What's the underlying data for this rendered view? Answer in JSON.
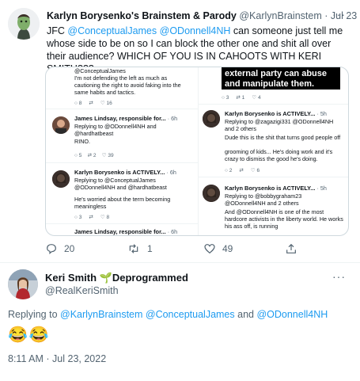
{
  "tweet1": {
    "display_name": "Karlyn Borysenko's Brainstem & Parody",
    "handle": "@KarlynBrainstem",
    "date": "· Jul 23",
    "text_prefix": "JFC ",
    "mention1": "@ConceptualJames",
    "mention2": "@ODonnell4NH",
    "text_rest": " can someone just tell me whose side to be on so I can block the other one and shit all over their audience? WHICH OF YOU IS IN CAHOOTS WITH KERI SMITH???",
    "actions": {
      "reply_count": "20",
      "retweet_count": "1",
      "like_count": "49"
    }
  },
  "screenshot": {
    "left": {
      "top_mention": "@ConceptualJames",
      "top_text": "I'm not defending the left as much as cautioning the right to avoid faking into the same habits and tactics.",
      "top_actions": [
        "8",
        "16"
      ],
      "reply1_name": "James Lindsay, responsible for...",
      "reply1_time": "· 6h",
      "reply1_replying": "Replying to @ODonnell4NH and @hardhatbeast",
      "reply1_text": "RINO.",
      "reply1_actions": [
        "5",
        "2",
        "39"
      ],
      "reply2_name": "Karlyn Borysenko is ACTIVELY...",
      "reply2_time": "· 6h",
      "reply2_replying": "Replying to @ConceptualJames @ODonnell4NH and @hardhatbeast",
      "reply2_text": "He's worried about the term becoming meaningless",
      "reply2_actions": [
        "3",
        "8"
      ],
      "reply3_name": "James Lindsay, responsible for...",
      "reply3_time": "· 6h"
    },
    "right": {
      "banner_text": "external party can abuse and manipulate them.",
      "top_actions": [
        "3",
        "1",
        "4"
      ],
      "reply1_name": "Karlyn Borysenko is ACTIVELY...",
      "reply1_time": "· 5h",
      "reply1_replying": "Replying to @zagazigi331 @ODonnell4NH and 2 others",
      "reply1_text": "Dude this is the shit that turns good people off",
      "reply1_overlap": "grooming of kids... He's doing work and it's crazy to dismiss the good he's doing.",
      "reply1_actions": [
        "2",
        "6"
      ],
      "reply2_name": "Karlyn Borysenko is ACTIVELY...",
      "reply2_time": "· 5h",
      "reply2_replying": "Replying to @bobbygraham23 @ODonnell4NH and 2 others",
      "reply2_text": "And @ODonnell4NH is one of the most hardcore activists in the liberty world. He works his ass off, is running"
    }
  },
  "tweet2": {
    "display_name": "Keri Smith",
    "badge": "🌱Deprogrammed",
    "handle": "@RealKeriSmith",
    "replying_prefix": "Replying to ",
    "replying_m1": "@KarlynBrainstem",
    "replying_m2": "@ConceptualJames",
    "replying_and": " and ",
    "replying_m3": "@ODonnell4NH",
    "text": "😂😂",
    "timestamp": "8:11 AM · Jul 23, 2022"
  },
  "colors": {
    "accent": "#1d9bf0",
    "muted": "#536471",
    "border": "#cfd9de"
  },
  "icons": [
    "reply-icon",
    "retweet-icon",
    "like-icon",
    "share-icon",
    "more-icon"
  ]
}
